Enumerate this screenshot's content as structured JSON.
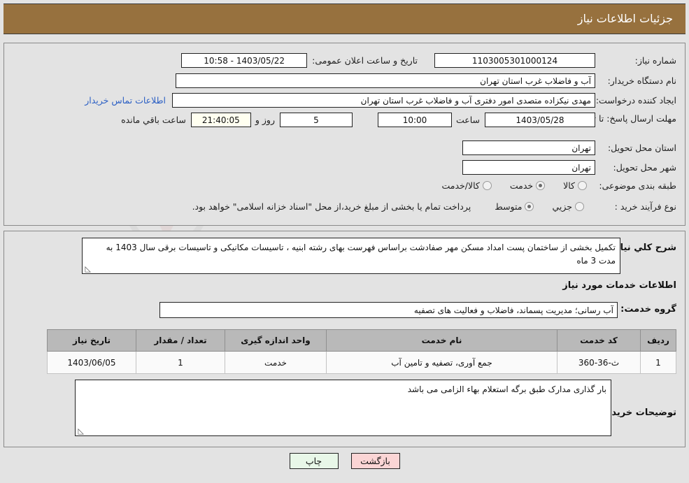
{
  "header": {
    "title": "جزئیات اطلاعات نیاز"
  },
  "form": {
    "need_number_label": "شماره نیاز:",
    "need_number_value": "1103005301000124",
    "announce_datetime_label": "تاریخ و ساعت اعلان عمومی:",
    "announce_datetime_value": "1403/05/22 - 10:58",
    "buyer_org_label": "نام دستگاه خریدار:",
    "buyer_org_value": "آب و فاضلاب غرب استان تهران",
    "creator_label": "ایجاد کننده درخواست:",
    "creator_value": "مهدی نیکزاده متصدی امور دفتری آب و فاضلاب غرب استان تهران",
    "contact_link": "اطلاعات تماس خریدار",
    "deadline_label": "مهلت ارسال پاسخ: تا تاریخ:",
    "deadline_date": "1403/05/28",
    "hour_label": "ساعت",
    "hour_value": "10:00",
    "days_value": "5",
    "days_label": "روز و",
    "remaining_value": "21:40:05",
    "remaining_label": "ساعت باقي مانده",
    "province_label": "استان محل تحویل:",
    "province_value": "تهران",
    "city_label": "شهر محل تحویل:",
    "city_value": "تهران",
    "classification_label": "طبقه بندی موضوعی:",
    "classification_options": [
      {
        "label": "کالا",
        "selected": false
      },
      {
        "label": "خدمت",
        "selected": true
      },
      {
        "label": "کالا/خدمت",
        "selected": false
      }
    ],
    "process_label": "نوع فرآیند خرید :",
    "process_options": [
      {
        "label": "جزيي",
        "selected": false
      },
      {
        "label": "متوسط",
        "selected": true
      }
    ],
    "treasury_note": "پرداخت تمام یا بخشی از مبلغ خرید،از محل \"اسناد خزانه اسلامی\" خواهد بود."
  },
  "description": {
    "label": "شرح کلي نیاز:",
    "value": "تکمیل بخشی از ساختمان پست امداد مسکن مهر صفادشت براساس فهرست بهای رشته ابنیه ، تاسیسات مکانیکی و تاسیسات برقی سال 1403 به مدت 3 ماه"
  },
  "services_section": {
    "heading": "اطلاعات خدمات مورد نیاز",
    "group_label": "گروه خدمت:",
    "group_value": "آب رسانی؛ مدیریت پسماند، فاضلاب و فعالیت های تصفیه"
  },
  "table": {
    "columns": [
      "ردیف",
      "کد خدمت",
      "نام خدمت",
      "واحد اندازه گیری",
      "تعداد / مقدار",
      "تاریخ نیاز"
    ],
    "rows": [
      {
        "index": "1",
        "code": "ث-36-360",
        "name": "جمع آوری، تصفیه و تامین آب",
        "unit": "خدمت",
        "quantity": "1",
        "need_date": "1403/06/05"
      }
    ]
  },
  "buyer_notes": {
    "label": "توضیحات خریدار:",
    "value": "بار گذاری مدارک طبق برگه استعلام بهاء الزامی می باشد"
  },
  "buttons": {
    "print": "چاپ",
    "back": "بازگشت"
  },
  "watermark": {
    "text_main": "AriaTender",
    "text_dot": ".net"
  },
  "colors": {
    "title_bar": "#97713e",
    "page_bg": "#e3e3e3",
    "link": "#2b5fc4",
    "table_header": "#b9b9b9",
    "btn_print": "#e8f7e8",
    "btn_back": "#fbd5d5",
    "timer_bg": "#fffff0"
  }
}
